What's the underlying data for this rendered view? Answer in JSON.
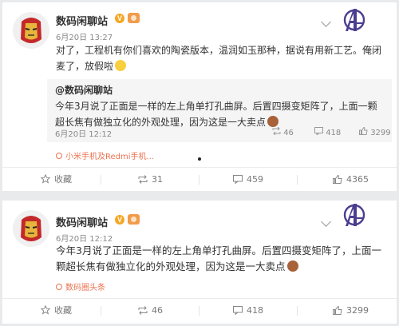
{
  "post1": {
    "author": "数码闲聊站",
    "time": "6月20日 13:27",
    "text": "对了，工程机有你们喜欢的陶瓷版本，温润如玉那种，据说有用新工艺。俺闭麦了，放假啦",
    "repost": {
      "author": "@数码闲聊站",
      "text": "今年3月说了正面是一样的左上角单打孔曲屏。后置四摄变矩阵了，上面一颗超长焦有做独立化的外观处理，因为这是一大卖点",
      "time": "6月20日 12:12",
      "reposts": "46",
      "comments": "418",
      "likes": "3299"
    },
    "source": "小米手机及Redmi手机...",
    "actions": {
      "favorite": "收藏",
      "reposts": "31",
      "comments": "459",
      "likes": "4365"
    }
  },
  "post2": {
    "author": "数码闲聊站",
    "time": "6月20日 12:12",
    "text": "今年3月说了正面是一样的左上角单打孔曲屏。后置四摄变矩阵了，上面一颗超长焦有做独立化的外观处理，因为这是一大卖点",
    "source": "数码圈头条",
    "actions": {
      "favorite": "收藏",
      "reposts": "46",
      "comments": "418",
      "likes": "3299"
    }
  },
  "icons": {
    "avatar": "iron-man-avatar",
    "verified": "verified-badge-icon",
    "brand": "avengers-logo-icon",
    "favorite": "star-icon",
    "repost": "repost-icon",
    "comment": "comment-icon",
    "like": "thumbs-up-icon"
  },
  "colors": {
    "accent": "#eb7350",
    "verified": "#f5a623",
    "brand": "#4b3d8f",
    "link": "#eb7350"
  }
}
